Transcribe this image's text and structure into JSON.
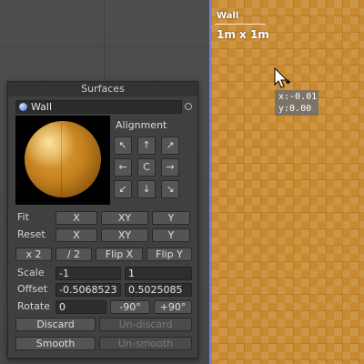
{
  "scene": {
    "wall_label": "Wall",
    "wall_size": "1m x 1m",
    "coord_x": "x:-0.01",
    "coord_y": "y:0.00"
  },
  "panel": {
    "title": "Surfaces",
    "material_name": "Wall",
    "alignment_label": "Alignment",
    "alignment_buttons": [
      "↖",
      "↑",
      "↗",
      "←",
      "C",
      "→",
      "↙",
      "↓",
      "↘"
    ],
    "fit": {
      "label": "Fit",
      "x": "X",
      "xy": "XY",
      "y": "Y"
    },
    "reset": {
      "label": "Reset",
      "x": "X",
      "xy": "XY",
      "y": "Y"
    },
    "scale_buttons": {
      "times2": "x 2",
      "div2": "/ 2",
      "flip_x": "Flip X",
      "flip_y": "Flip Y"
    },
    "scale": {
      "label": "Scale",
      "x": "-1",
      "y": "1"
    },
    "offset": {
      "label": "Offset",
      "x": "-0.5068523",
      "y": "0.5025085"
    },
    "rotate": {
      "label": "Rotate",
      "value": "0",
      "minus90": "-90°",
      "plus90": "+90°"
    },
    "discard": "Discard",
    "undiscard": "Un-discard",
    "smooth": "Smooth",
    "unsmooth": "Un-smooth"
  },
  "colors": {
    "wall": "#c8892f",
    "wall_edge": "#7b7fd6",
    "panel_bg": "#404040"
  }
}
